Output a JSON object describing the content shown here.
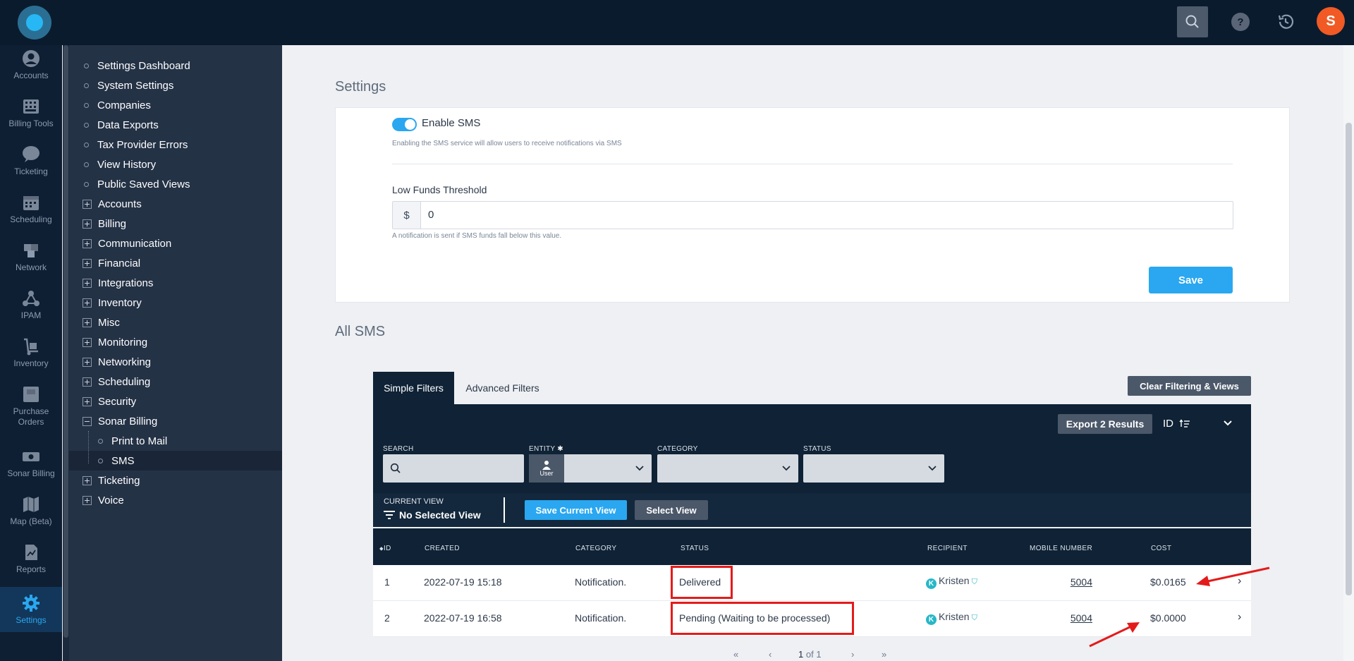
{
  "topbar": {
    "avatar_initial": "S",
    "help_label": "?"
  },
  "rail": [
    {
      "label": "Accounts",
      "icon": "user-icon"
    },
    {
      "label": "Billing Tools",
      "icon": "calculator-icon"
    },
    {
      "label": "Ticketing",
      "icon": "chat-bubble-icon"
    },
    {
      "label": "Scheduling",
      "icon": "calendar-icon"
    },
    {
      "label": "Network",
      "icon": "cubes-icon"
    },
    {
      "label": "IPAM",
      "icon": "network-nodes-icon"
    },
    {
      "label": "Inventory",
      "icon": "hand-truck-icon"
    },
    {
      "label": "Purchase",
      "label2": "Orders",
      "icon": "purchase-orders-icon"
    },
    {
      "label": "Sonar Billing",
      "icon": "money-icon"
    },
    {
      "label": "Map (Beta)",
      "icon": "map-icon"
    },
    {
      "label": "Reports",
      "icon": "report-icon"
    },
    {
      "label": "Settings",
      "icon": "gear-icon"
    }
  ],
  "tree": {
    "leaves": [
      "Settings Dashboard",
      "System Settings",
      "Companies",
      "Data Exports",
      "Tax Provider Errors",
      "View History",
      "Public Saved Views"
    ],
    "groups": [
      "Accounts",
      "Billing",
      "Communication",
      "Financial",
      "Integrations",
      "Inventory",
      "Misc",
      "Monitoring",
      "Networking",
      "Scheduling",
      "Security",
      "Sonar Billing"
    ],
    "sonar_children": [
      "Print to Mail",
      "SMS"
    ],
    "groups_after": [
      "Ticketing",
      "Voice"
    ]
  },
  "settings": {
    "title": "Settings",
    "enable_label": "Enable SMS",
    "enable_help": "Enabling the SMS service will allow users to receive notifications via SMS",
    "threshold_label": "Low Funds Threshold",
    "threshold_prefix": "$",
    "threshold_value": "0",
    "threshold_help": "A notification is sent if SMS funds fall below this value.",
    "save_label": "Save"
  },
  "sms": {
    "title": "All SMS",
    "tab_simple": "Simple Filters",
    "tab_advanced": "Advanced Filters",
    "clear_label": "Clear Filtering & Views",
    "export_label": "Export 2 Results",
    "sort_label": "ID",
    "filters": {
      "search": "SEARCH",
      "entity": "ENTITY",
      "entity_chip": "User",
      "category": "CATEGORY",
      "status": "STATUS"
    },
    "current_view_label": "CURRENT VIEW",
    "current_view_value": "No Selected View",
    "save_view_label": "Save Current View",
    "select_view_label": "Select View",
    "columns": [
      "ID",
      "CREATED",
      "CATEGORY",
      "STATUS",
      "RECIPIENT",
      "MOBILE NUMBER",
      "COST"
    ],
    "rows": [
      {
        "id": "1",
        "created": "2022-07-19 15:18",
        "category": "Notification.",
        "status": "Delivered",
        "recipient": "Kristen",
        "mobile": "5004",
        "cost": "$0.0165"
      },
      {
        "id": "2",
        "created": "2022-07-19 16:58",
        "category": "Notification.",
        "status": "Pending (Waiting to be processed)",
        "recipient": "Kristen",
        "mobile": "5004",
        "cost": "$0.0000"
      }
    ],
    "pager": {
      "first": "«",
      "prev": "‹",
      "page": "1",
      "of": "of 1",
      "next": "›",
      "last": "»"
    }
  },
  "colors": {
    "accent": "#2aa7f0",
    "dark": "#0f2236",
    "highlight": "#e41b1b",
    "avatar": "#f15a24"
  }
}
